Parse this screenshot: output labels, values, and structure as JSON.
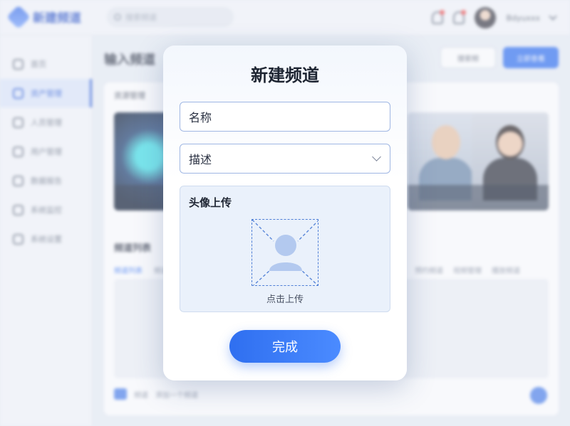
{
  "app": {
    "brand": "新建频道"
  },
  "header": {
    "search_placeholder": "搜索频道",
    "username": "Bdyuxxx"
  },
  "sidebar": {
    "items": [
      {
        "label": "首页",
        "active": false
      },
      {
        "label": "资产管理",
        "active": true
      },
      {
        "label": "人员管理",
        "active": false
      },
      {
        "label": "用户管理",
        "active": false
      },
      {
        "label": "数据报告",
        "active": false
      },
      {
        "label": "系统监控",
        "active": false
      },
      {
        "label": "系统设置",
        "active": false
      }
    ]
  },
  "main": {
    "title": "输入频道",
    "btn_search": "搜索频",
    "btn_primary": "立即查看",
    "panel1_title": "资源管理",
    "panel2_title": "频道列表",
    "tabs_left": [
      "频道列表",
      "频道详情"
    ],
    "tabs_right": [
      "预约频道",
      "视频管理",
      "播放频道"
    ],
    "footer_text": "频道",
    "footer_sub": "添加一个频道"
  },
  "modal": {
    "title": "新建频道",
    "name_placeholder": "名称",
    "desc_placeholder": "描述",
    "upload_title": "头像上传",
    "upload_hint": "点击上传",
    "done_label": "完成"
  },
  "colors": {
    "accent": "#2f6ff0",
    "dashed_border": "#4f7fd6",
    "upload_bg": "#eaf1fb"
  }
}
